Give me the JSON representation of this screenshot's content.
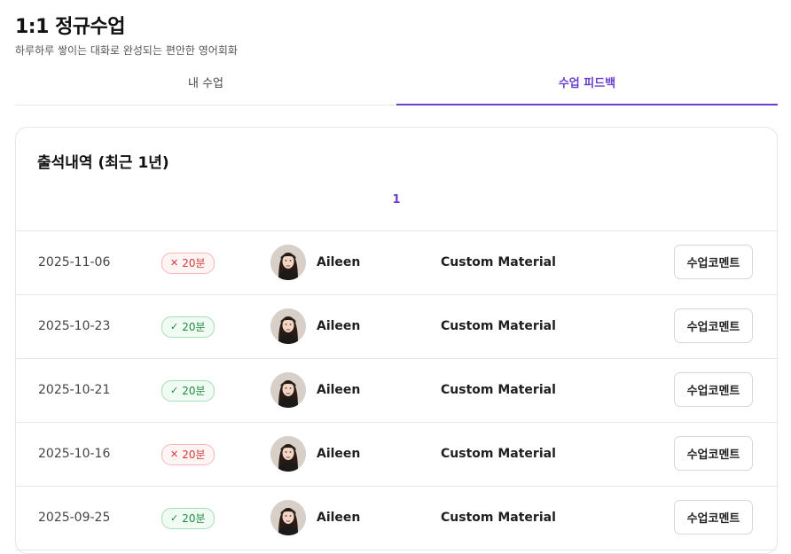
{
  "page": {
    "title": "1:1 정규수업",
    "subtitle": "하루하루 쌓이는 대화로 완성되는 편안한 영어회화"
  },
  "tabs": [
    {
      "label": "내 수업",
      "active": false
    },
    {
      "label": "수업 피드백",
      "active": true
    }
  ],
  "attendance": {
    "title": "출석내역 (최근 1년)",
    "current_page": "1",
    "rows": [
      {
        "date": "2025-11-06",
        "status": "absent",
        "duration": "20분",
        "tutor": "Aileen",
        "material": "Custom Material",
        "button": "수업코멘트"
      },
      {
        "date": "2025-10-23",
        "status": "attended",
        "duration": "20분",
        "tutor": "Aileen",
        "material": "Custom Material",
        "button": "수업코멘트"
      },
      {
        "date": "2025-10-21",
        "status": "attended",
        "duration": "20분",
        "tutor": "Aileen",
        "material": "Custom Material",
        "button": "수업코멘트"
      },
      {
        "date": "2025-10-16",
        "status": "absent",
        "duration": "20분",
        "tutor": "Aileen",
        "material": "Custom Material",
        "button": "수업코멘트"
      },
      {
        "date": "2025-09-25",
        "status": "attended",
        "duration": "20분",
        "tutor": "Aileen",
        "material": "Custom Material",
        "button": "수업코멘트"
      }
    ]
  },
  "colors": {
    "accent": "#6a3fd0",
    "absent": "#d23a3a",
    "attended": "#1f8a46"
  },
  "icons": {
    "absent": "x-icon",
    "attended": "check-icon"
  }
}
